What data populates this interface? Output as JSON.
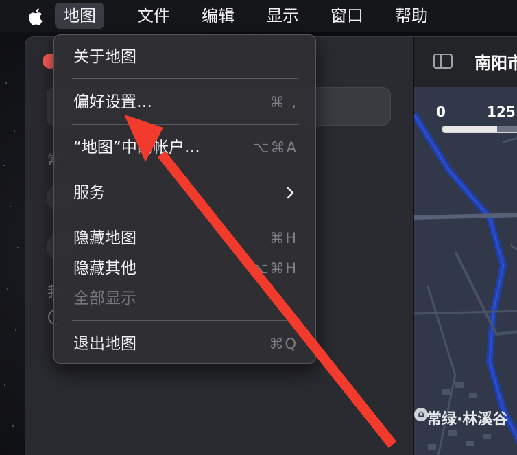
{
  "menubar": {
    "items": [
      {
        "label": "地图",
        "active": true
      },
      {
        "label": "文件"
      },
      {
        "label": "编辑"
      },
      {
        "label": "显示"
      },
      {
        "label": "窗口"
      },
      {
        "label": "帮助"
      }
    ]
  },
  "dropdown": {
    "items": [
      {
        "label": "关于地图",
        "shortcut": ""
      },
      {
        "label": "偏好设置…",
        "shortcut": "⌘ ,"
      },
      {
        "label": "“地图”中的帐户…",
        "shortcut": "⌥⌘A"
      },
      {
        "label": "服务",
        "shortcut": ""
      },
      {
        "label": "隐藏地图",
        "shortcut": "⌘H"
      },
      {
        "label": "隐藏其他",
        "shortcut": "⌥⌘H"
      },
      {
        "label": "全部显示",
        "shortcut": "",
        "disabled": true
      },
      {
        "label": "退出地图",
        "shortcut": "⌘Q"
      }
    ]
  },
  "map": {
    "title": "南阳市",
    "scale": {
      "start": "0",
      "mid": "125"
    },
    "poi": "常绿·林溪谷"
  },
  "colors": {
    "annotation_arrow": "#f23b2c",
    "route": "#1f3fae",
    "menu_bg": "#2f3034"
  }
}
